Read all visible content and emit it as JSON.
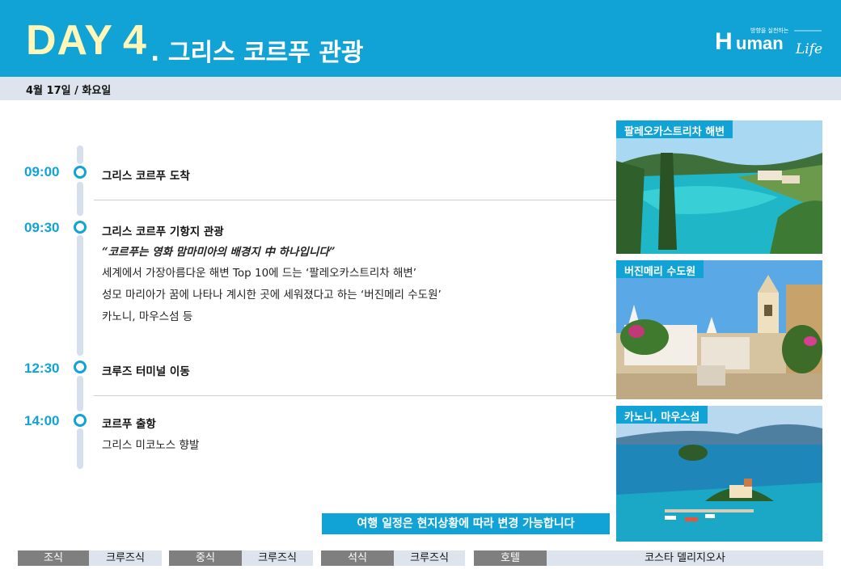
{
  "header": {
    "day_word": "DAY",
    "day_number": "4",
    "title": ". 그리스 코르푸 관광",
    "logo_small": "방향을 실천하는",
    "logo_main": "uman",
    "logo_script": "Life"
  },
  "date_bar": {
    "text": "4월 17일 / 화요일"
  },
  "schedule": [
    {
      "time": "09:00",
      "title": "그리스 코르푸 도착",
      "lines": []
    },
    {
      "time": "09:30",
      "title": "그리스 코르푸 기항지 관광",
      "highlight": "“코르푸는 영화 맘마미아의 배경지 中 하나입니다”",
      "lines": [
        "세계에서 가장아름다운 해변 Top 10에 드는 ‘팔레오카스트리차 해변’",
        "성모 마리아가 꿈에 나타나 계시한 곳에 세워졌다고 하는 ‘버진메리 수도원’",
        "카노니, 마우스섬 등"
      ]
    },
    {
      "time": "12:30",
      "title": "크루즈 터미널 이동",
      "lines": []
    },
    {
      "time": "14:00",
      "title": "코르푸 출항",
      "lines": [
        "그리스 미코노스 향발"
      ]
    }
  ],
  "photos": [
    {
      "label": "팔레오카스트리차 해변",
      "icon": "beach-photo"
    },
    {
      "label": "버진메리 수도원",
      "icon": "monastery-photo"
    },
    {
      "label": "카노니, 마우스섬",
      "icon": "island-photo"
    }
  ],
  "notice": "여행 일정은 현지상황에 따라 변경 가능합니다",
  "meals": {
    "breakfast_label": "조식",
    "breakfast_value": "크루즈식",
    "lunch_label": "중식",
    "lunch_value": "크루즈식",
    "dinner_label": "석식",
    "dinner_value": "크루즈식",
    "hotel_label": "호텔",
    "hotel_value": "코스타 델리지오사"
  },
  "colors": {
    "accent": "#12a3d6",
    "day_text": "#fff6b8",
    "bar": "#dde4ee",
    "label_gray": "#7f7f7f"
  }
}
